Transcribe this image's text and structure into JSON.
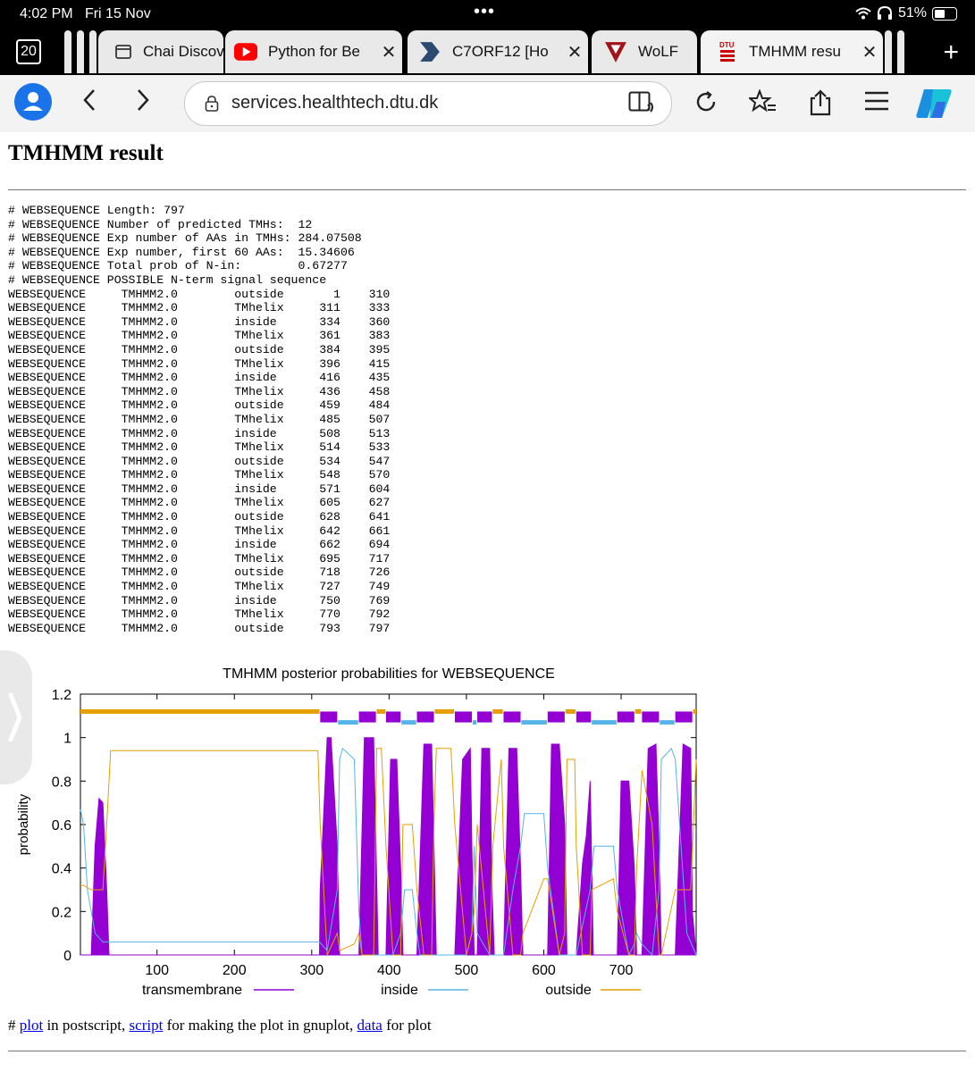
{
  "status": {
    "time": "4:02 PM",
    "date": "Fri 15 Nov",
    "battery": "51%"
  },
  "tabs": {
    "count": "20",
    "items": [
      {
        "label": "Chai Discov"
      },
      {
        "label": "Python for Be"
      },
      {
        "label": "C7ORF12 [Ho"
      },
      {
        "label": "WoLF"
      },
      {
        "label": "TMHMM resu"
      }
    ]
  },
  "address": {
    "url": "services.healthtech.dtu.dk"
  },
  "page": {
    "title": "TMHMM result",
    "summary": [
      "# WEBSEQUENCE Length: 797",
      "# WEBSEQUENCE Number of predicted TMHs:  12",
      "# WEBSEQUENCE Exp number of AAs in TMHs: 284.07508",
      "# WEBSEQUENCE Exp number, first 60 AAs:  15.34606",
      "# WEBSEQUENCE Total prob of N-in:        0.67277",
      "# WEBSEQUENCE POSSIBLE N-term signal sequence"
    ],
    "seq_name": "WEBSEQUENCE",
    "method": "TMHMM2.0",
    "rows": [
      [
        "outside",
        "1",
        "310"
      ],
      [
        "TMhelix",
        "311",
        "333"
      ],
      [
        "inside",
        "334",
        "360"
      ],
      [
        "TMhelix",
        "361",
        "383"
      ],
      [
        "outside",
        "384",
        "395"
      ],
      [
        "TMhelix",
        "396",
        "415"
      ],
      [
        "inside",
        "416",
        "435"
      ],
      [
        "TMhelix",
        "436",
        "458"
      ],
      [
        "outside",
        "459",
        "484"
      ],
      [
        "TMhelix",
        "485",
        "507"
      ],
      [
        "inside",
        "508",
        "513"
      ],
      [
        "TMhelix",
        "514",
        "533"
      ],
      [
        "outside",
        "534",
        "547"
      ],
      [
        "TMhelix",
        "548",
        "570"
      ],
      [
        "inside",
        "571",
        "604"
      ],
      [
        "TMhelix",
        "605",
        "627"
      ],
      [
        "outside",
        "628",
        "641"
      ],
      [
        "TMhelix",
        "642",
        "661"
      ],
      [
        "inside",
        "662",
        "694"
      ],
      [
        "TMhelix",
        "695",
        "717"
      ],
      [
        "outside",
        "718",
        "726"
      ],
      [
        "TMhelix",
        "727",
        "749"
      ],
      [
        "inside",
        "750",
        "769"
      ],
      [
        "TMhelix",
        "770",
        "792"
      ],
      [
        "outside",
        "793",
        "797"
      ]
    ],
    "footer": {
      "hash": "# ",
      "link_plot": "plot",
      "t1": " in postscript, ",
      "link_script": "script",
      "t2": " for making the plot in gnuplot, ",
      "link_data": "data",
      "t3": " for plot"
    }
  },
  "chart_data": {
    "type": "line",
    "title": "TMHMM posterior probabilities for WEBSEQUENCE",
    "ylabel": "probability",
    "xlabel": "",
    "xlim": [
      1,
      797
    ],
    "ylim": [
      0,
      1.2
    ],
    "xticks": [
      100,
      200,
      300,
      400,
      500,
      600,
      700
    ],
    "yticks": [
      "0",
      "0.2",
      "0.4",
      "0.6",
      "0.8",
      "1",
      "1.2"
    ],
    "legend": [
      "transmembrane",
      "inside",
      "outside"
    ],
    "colors": {
      "transmembrane": "#9400d3",
      "inside": "#56b4e9",
      "outside": "#e69f00"
    },
    "series": [
      {
        "name": "transmembrane",
        "x": [
          1,
          15,
          20,
          25,
          30,
          35,
          38,
          42,
          50,
          60,
          300,
          310,
          311,
          320,
          325,
          333,
          336,
          361,
          368,
          380,
          383,
          386,
          396,
          402,
          410,
          415,
          418,
          436,
          445,
          455,
          458,
          461,
          485,
          495,
          505,
          507,
          510,
          514,
          520,
          530,
          533,
          536,
          548,
          555,
          565,
          570,
          573,
          605,
          610,
          620,
          627,
          630,
          642,
          650,
          655,
          660,
          661,
          664,
          695,
          700,
          710,
          717,
          720,
          727,
          735,
          745,
          749,
          752,
          770,
          780,
          790,
          792,
          797
        ],
        "y": [
          0,
          0,
          0.5,
          0.72,
          0.7,
          0.3,
          0,
          0,
          0,
          0,
          0,
          0,
          0.3,
          1,
          1,
          0.5,
          0,
          0,
          1,
          1,
          0.5,
          0,
          0,
          0.9,
          0.9,
          0.4,
          0,
          0,
          0.97,
          0.97,
          0.5,
          0,
          0,
          0.9,
          0.95,
          0.5,
          0,
          0,
          0.95,
          0.95,
          0.3,
          0,
          0,
          0.95,
          0.95,
          0.4,
          0,
          0,
          0.97,
          0.97,
          0.6,
          0,
          0,
          0.42,
          0.55,
          0.8,
          0.6,
          0,
          0,
          0.8,
          0.8,
          0.4,
          0,
          0,
          0.95,
          0.97,
          0.5,
          0,
          0,
          0.97,
          0.95,
          0.2,
          0
        ]
      },
      {
        "name": "inside",
        "x": [
          1,
          5,
          10,
          20,
          30,
          40,
          50,
          60,
          300,
          310,
          320,
          333,
          336,
          340,
          355,
          361,
          365,
          380,
          384,
          390,
          396,
          405,
          415,
          420,
          430,
          436,
          440,
          455,
          460,
          480,
          485,
          500,
          507,
          510,
          514,
          530,
          534,
          545,
          548,
          560,
          570,
          575,
          600,
          605,
          620,
          627,
          630,
          640,
          642,
          660,
          665,
          690,
          695,
          710,
          717,
          720,
          727,
          740,
          749,
          752,
          765,
          770,
          785,
          797
        ],
        "y": [
          0.67,
          0.6,
          0.3,
          0.1,
          0.06,
          0.06,
          0.06,
          0.06,
          0.06,
          0.06,
          0.02,
          0.3,
          0.9,
          0.95,
          0.9,
          0.2,
          0,
          0,
          0,
          0,
          0,
          0,
          0.1,
          0.3,
          0.3,
          0.1,
          0,
          0,
          0,
          0,
          0,
          0,
          0.1,
          0.5,
          0.1,
          0,
          0,
          0,
          0,
          0.3,
          0.5,
          0.65,
          0.65,
          0.4,
          0,
          0,
          0,
          0,
          0,
          0.3,
          0.5,
          0.5,
          0.3,
          0,
          0.05,
          0.1,
          0.05,
          0,
          0.3,
          0.9,
          0.95,
          0.9,
          0.1,
          0
        ]
      },
      {
        "name": "outside",
        "x": [
          1,
          5,
          15,
          25,
          30,
          35,
          38,
          40,
          50,
          60,
          100,
          200,
          300,
          308,
          311,
          320,
          333,
          336,
          355,
          361,
          365,
          380,
          384,
          390,
          396,
          405,
          415,
          418,
          430,
          436,
          445,
          455,
          458,
          461,
          480,
          485,
          500,
          507,
          510,
          514,
          530,
          534,
          545,
          548,
          560,
          570,
          573,
          600,
          605,
          620,
          627,
          630,
          640,
          642,
          650,
          660,
          662,
          690,
          695,
          710,
          717,
          720,
          727,
          740,
          749,
          752,
          770,
          790,
          797
        ],
        "y": [
          0.32,
          0.32,
          0.3,
          0.3,
          0.3,
          0.6,
          0.8,
          0.94,
          0.94,
          0.94,
          0.94,
          0.94,
          0.94,
          0.94,
          0.6,
          0,
          0.1,
          0.02,
          0.05,
          0.1,
          0,
          0,
          0.95,
          0.95,
          0.5,
          0,
          0,
          0.6,
          0.6,
          0.3,
          0,
          0,
          0.6,
          0.95,
          0.95,
          0.6,
          0,
          0.1,
          0.2,
          0.6,
          0,
          0.5,
          0.9,
          0.5,
          0,
          0,
          0.1,
          0.35,
          0.35,
          0,
          0.1,
          0.9,
          0.9,
          0.5,
          0,
          0,
          0.3,
          0.35,
          0.2,
          0,
          0,
          0.4,
          0.85,
          0.6,
          0,
          0,
          0.3,
          0.3,
          0.9
        ]
      }
    ],
    "topbar": [
      [
        "outside",
        1,
        310
      ],
      [
        "TMhelix",
        311,
        333
      ],
      [
        "inside",
        334,
        360
      ],
      [
        "TMhelix",
        361,
        383
      ],
      [
        "outside",
        384,
        395
      ],
      [
        "TMhelix",
        396,
        415
      ],
      [
        "inside",
        416,
        435
      ],
      [
        "TMhelix",
        436,
        458
      ],
      [
        "outside",
        459,
        484
      ],
      [
        "TMhelix",
        485,
        507
      ],
      [
        "inside",
        508,
        513
      ],
      [
        "TMhelix",
        514,
        533
      ],
      [
        "outside",
        534,
        547
      ],
      [
        "TMhelix",
        548,
        570
      ],
      [
        "inside",
        571,
        604
      ],
      [
        "TMhelix",
        605,
        627
      ],
      [
        "outside",
        628,
        641
      ],
      [
        "TMhelix",
        642,
        661
      ],
      [
        "inside",
        662,
        694
      ],
      [
        "TMhelix",
        695,
        717
      ],
      [
        "outside",
        718,
        726
      ],
      [
        "TMhelix",
        727,
        749
      ],
      [
        "inside",
        750,
        769
      ],
      [
        "TMhelix",
        770,
        792
      ],
      [
        "outside",
        793,
        797
      ]
    ]
  }
}
